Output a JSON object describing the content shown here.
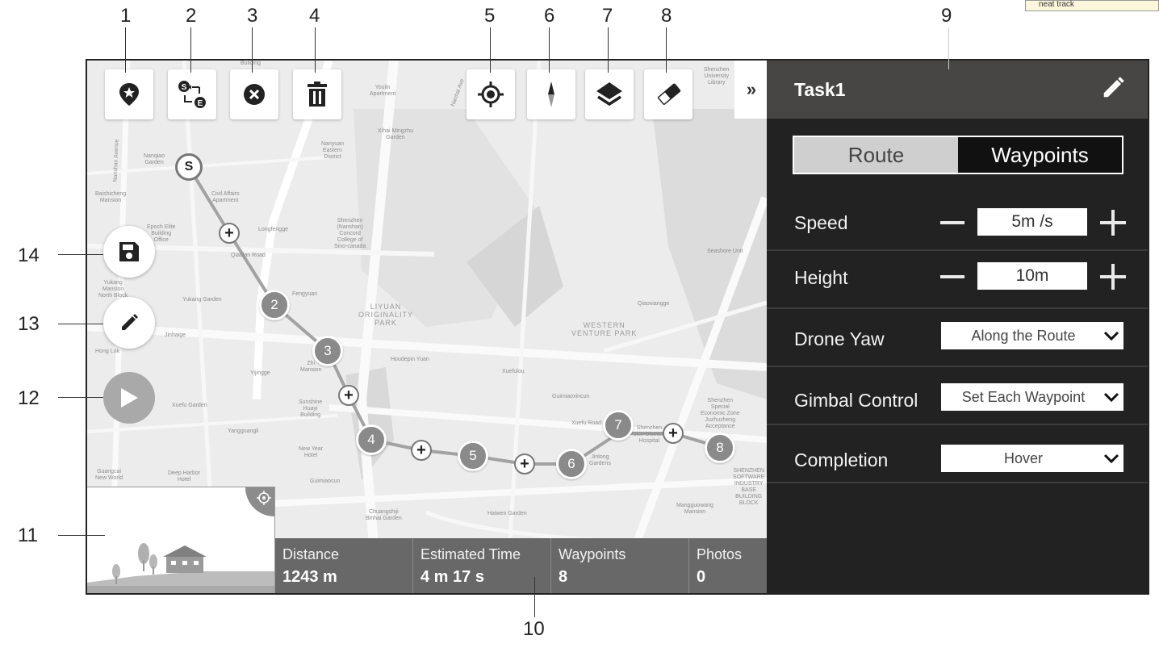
{
  "callouts": {
    "c1": "1",
    "c2": "2",
    "c3": "3",
    "c4": "4",
    "c5": "5",
    "c6": "6",
    "c7": "7",
    "c8": "8",
    "c9": "9",
    "c10": "10",
    "c11": "11",
    "c12": "12",
    "c13": "13",
    "c14": "14"
  },
  "note_text": "neat track",
  "toolbar": {
    "icons": [
      "map-pin-star-icon",
      "reverse-route-icon",
      "close-circle-icon",
      "trash-icon",
      "locate-icon",
      "compass-icon",
      "layers-icon",
      "eraser-icon"
    ],
    "expand_label": "»"
  },
  "side_buttons": [
    "save-icon",
    "pencil-icon",
    "play-icon"
  ],
  "route": {
    "start_label": "S",
    "waypoints": [
      "2",
      "3",
      "4",
      "5",
      "6",
      "7",
      "8"
    ],
    "plus_symbol": "+"
  },
  "map_labels": {
    "youlin": "Youlin\nApartment",
    "building": "Building",
    "xihai": "Xihai Mingzhu\nGarden",
    "nanyuan": "Nanyuan\nEastern\nDistrict",
    "nanqiao": "Nanqiao\nGarden",
    "baishicheng": "Baishicheng\nMansion",
    "civil": "Civil Affairs\nApartment",
    "longfengge": "Longfengge",
    "epoch": "Epoch Elite\nBuilding\nOffice",
    "college": "Shenzhen\n(Nanshan)\nConcord\nCollege of\nSino-canada",
    "qiaolan": "Qiaolan Road",
    "yukang": "Yukang\nMansion\nNorth Block",
    "yukanggarden": "Yukang Garden",
    "fengyuan": "Fengyuan",
    "liyuan": "LIYUAN\nORIGINALITY\nPARK",
    "jinhaige": "Jinhaige",
    "hongleek": "Hong Lok",
    "yijingge": "Yijingge",
    "zhm": "Zhi\nMansion",
    "sunshine": "Sunshine\nHuayi\nBuilding",
    "houdepin": "Houdepin Yuan",
    "xuefulou": "Xuefulou",
    "guimiaoxincun": "Guimiaoxincun",
    "qiaoxiangge": "Qiaoxiangge",
    "western": "WESTERN\nVENTURE PARK",
    "xuefugarden": "Xuefu Garden",
    "yangguangli": "Yangguangli",
    "newyear": "New Year\nHotel",
    "guangcai": "Guangcai\nNew World",
    "deepharbor": "Deep Harbor\nHotel",
    "guimiaocun": "Guimiaocun",
    "chuangshiji": "Chuangshiji\nBinhai Garden",
    "haiwen": "Haiwen Garden",
    "xuefuroad": "Xuefu Road",
    "skin": "Shenzhen\nSkin Disease\nHospital",
    "jinlong": "Jinlong\nGardens",
    "seza": "Shenzhen\nSpecial\nEconomic Zone\nJuzhuzheng\nAcceptance",
    "mangguo": "Mangguowang\nMansion",
    "seashore": "Seashore Unit",
    "univ": "Shenzhen\nUniversity\nLibrary",
    "nanhai": "Nanhai Ave",
    "nanshan": "Nanshan Avenue",
    "softpark": "SHENZHEN\nSOFTWARE\nINDUSTRY\nBASE\nBUILDING\nBLOCK"
  },
  "mini_view": {
    "target_icon": "crosshair-icon"
  },
  "stats": {
    "distance_label": "Distance",
    "distance_value": "1243 m",
    "time_label": "Estimated Time",
    "time_value": "4 m 17 s",
    "waypoints_label": "Waypoints",
    "waypoints_value": "8",
    "photos_label": "Photos",
    "photos_value": "0"
  },
  "panel": {
    "task_title": "Task1",
    "edit_icon": "pencil-icon",
    "tabs": [
      "Route",
      "Waypoints"
    ],
    "active_tab": "Route",
    "speed_label": "Speed",
    "speed_value": "5m /s",
    "height_label": "Height",
    "height_value": "10m",
    "yaw_label": "Drone Yaw",
    "yaw_value": "Along the Route",
    "gimbal_label": "Gimbal Control",
    "gimbal_value": "Set Each Waypoint",
    "completion_label": "Completion",
    "completion_value": "Hover"
  },
  "colors": {
    "panel_bg": "#222222",
    "panel_header": "#474645",
    "stats_bg": "#686868",
    "waypoint_fill": "#8a8a8a",
    "map_bg": "#ececec"
  }
}
